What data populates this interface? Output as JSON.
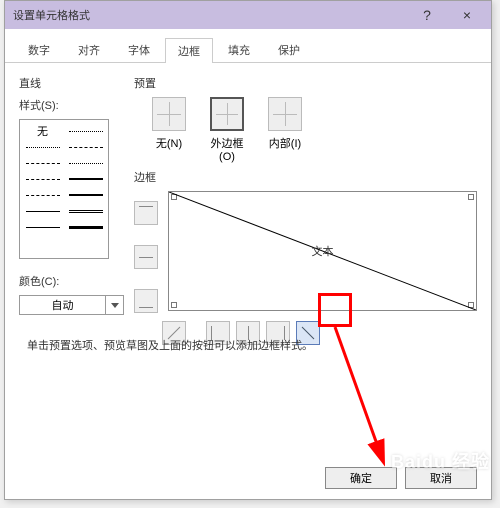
{
  "titlebar": {
    "title": "设置单元格格式",
    "help": "?",
    "close": "×"
  },
  "tabs": [
    "数字",
    "对齐",
    "字体",
    "边框",
    "填充",
    "保护"
  ],
  "active_tab_index": 3,
  "left": {
    "section": "直线",
    "style_label": "样式(S):",
    "none_label": "无",
    "color_label": "颜色(C):",
    "color_value": "自动"
  },
  "right": {
    "preset_label": "预置",
    "presets": [
      "无(N)",
      "外边框(O)",
      "内部(I)"
    ],
    "border_label": "边框",
    "preview_text": "文本"
  },
  "hint": "单击预置选项、预览草图及上面的按钮可以添加边框样式。",
  "footer": {
    "ok": "确定",
    "cancel": "取消"
  },
  "watermark": "Baidu 经验"
}
